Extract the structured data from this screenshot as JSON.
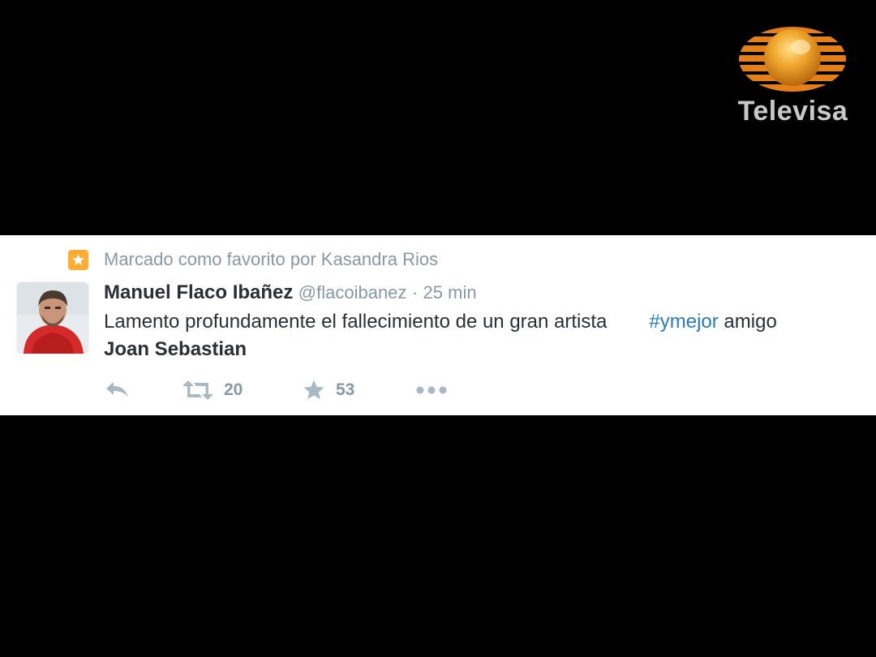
{
  "logo": {
    "text": "Televisa",
    "icon": "televisa-globe-icon",
    "colors": {
      "orange": "#e8821c",
      "gold": "#f2b233",
      "text": "#c9c9c9"
    }
  },
  "tweet": {
    "context_icon": "star-icon",
    "context_text": "Marcado como favorito por Kasandra Rios",
    "author_name": "Manuel Flaco Ibañez",
    "author_handle": "@flacoibanez",
    "separator": "·",
    "timestamp": "25 min",
    "body_text": "Lamento profundamente el fallecimiento de un gran artista",
    "hashtag": "#ymejor",
    "body_after_hashtag": "amigo",
    "body_bold": "Joan Sebastian",
    "actions": {
      "reply_icon": "reply-icon",
      "retweet_icon": "retweet-icon",
      "retweet_count": "20",
      "favorite_icon": "star-icon",
      "favorite_count": "53",
      "more_icon": "more-icon"
    },
    "colors": {
      "accent_favorite": "#ffac33",
      "hashtag": "#2b7bb9",
      "muted": "#8899a6",
      "text": "#292f33",
      "icon": "#aab8c2"
    }
  }
}
